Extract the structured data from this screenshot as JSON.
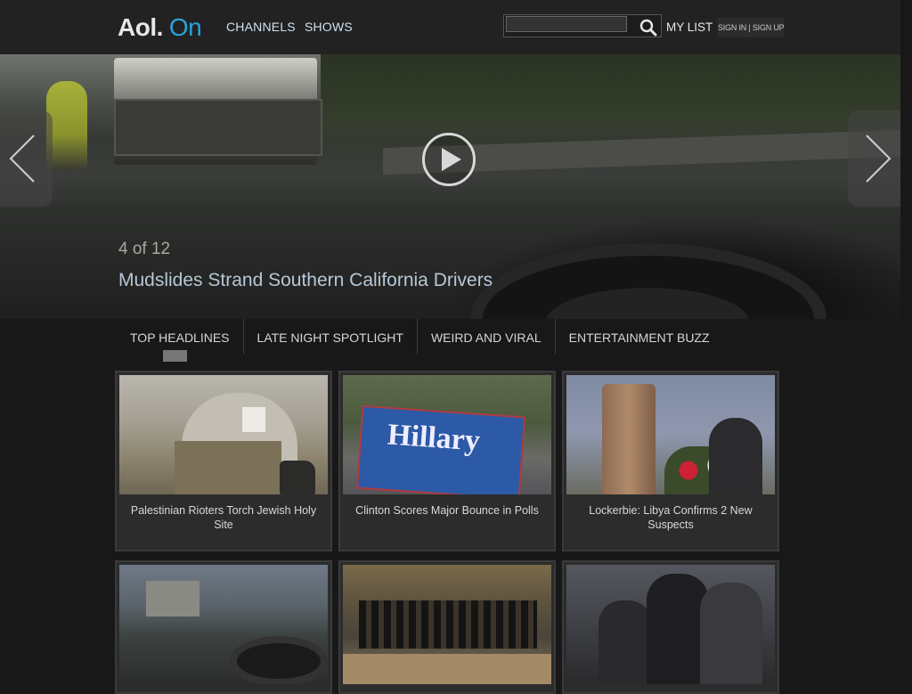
{
  "header": {
    "logo_main": "Aol.",
    "logo_sub": "On",
    "nav": [
      "CHANNELS",
      "SHOWS"
    ],
    "search_placeholder": "",
    "my_list": "MY LIST",
    "sign_in": "SIGN IN | SIGN UP"
  },
  "hero": {
    "counter": "4 of 12",
    "title": "Mudslides Strand Southern California Drivers"
  },
  "tabs": [
    "TOP HEADLINES",
    "LATE NIGHT SPOTLIGHT",
    "WEIRD AND VIRAL",
    "ENTERTAINMENT BUZZ"
  ],
  "cards": [
    {
      "caption": "Palestinian Rioters Torch Jewish Holy Site"
    },
    {
      "caption": "Clinton Scores Major Bounce in Polls",
      "thumb_text": "Hillary"
    },
    {
      "caption": "Lockerbie: Libya Confirms 2 New Suspects"
    },
    {
      "caption": ""
    },
    {
      "caption": ""
    },
    {
      "caption": ""
    }
  ],
  "colors": {
    "accent": "#29a3dd",
    "background": "#181818",
    "header": "#222222"
  }
}
